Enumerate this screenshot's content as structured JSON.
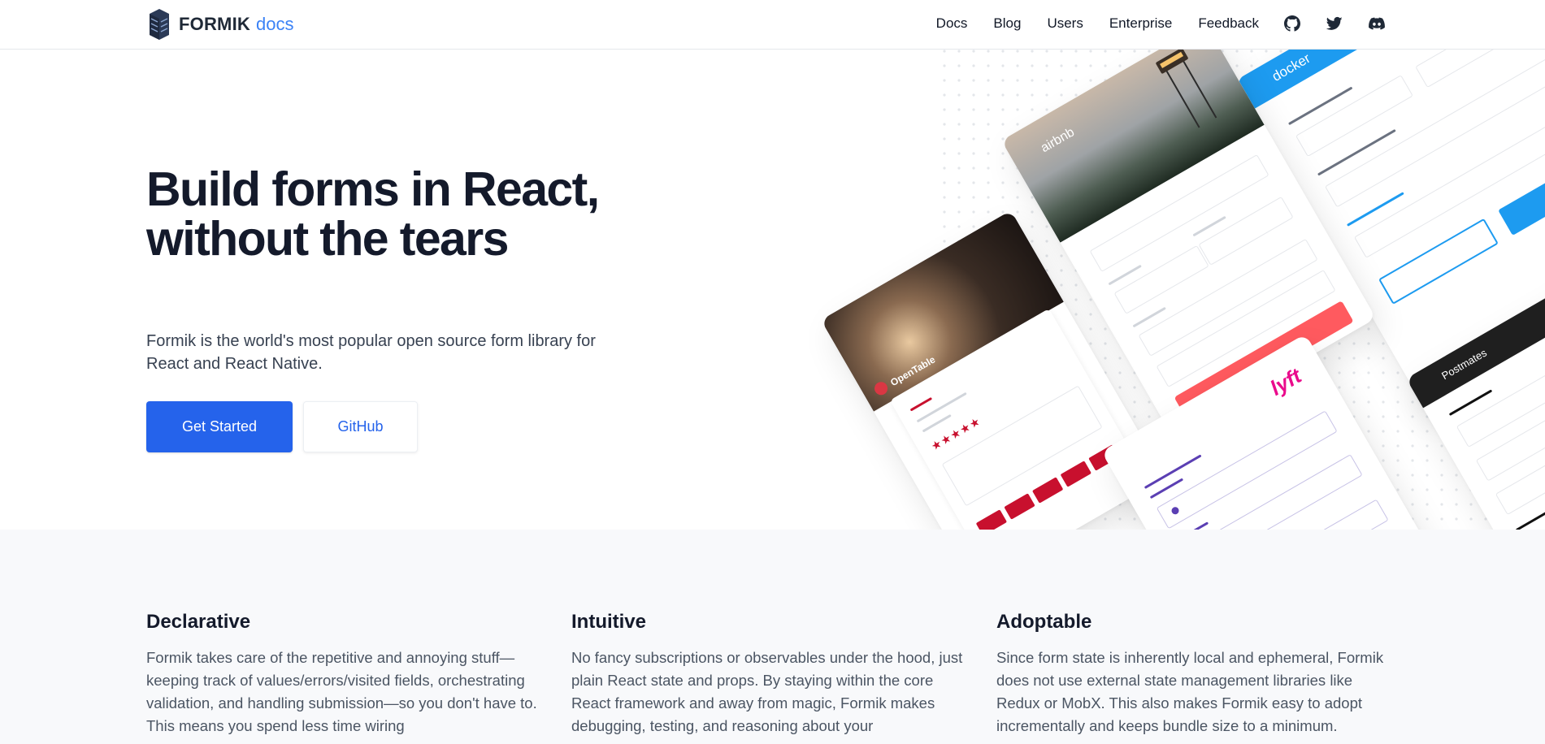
{
  "header": {
    "logo_word": "FORMIK",
    "logo_suffix": "docs",
    "nav": [
      {
        "label": "Docs"
      },
      {
        "label": "Blog"
      },
      {
        "label": "Users"
      },
      {
        "label": "Enterprise"
      },
      {
        "label": "Feedback"
      }
    ],
    "icons": [
      "github-icon",
      "twitter-icon",
      "discord-icon"
    ]
  },
  "hero": {
    "title": "Build forms in React, without the tears",
    "subtitle": "Formik is the world's most popular open source form library for React and React Native.",
    "primary_button": "Get Started",
    "secondary_button": "GitHub"
  },
  "collage": {
    "brands": [
      "airbnb",
      "docker",
      "OpenTable",
      "lyft",
      "Postmates"
    ],
    "rating_stars": "★★★★★",
    "colors": {
      "airbnb_button": "#ff5a5f",
      "docker_blue": "#1d9bf0",
      "opentable_red": "#c8102e",
      "lyft_pink": "#ea0b8c",
      "lyft_purple": "#5b3fb3",
      "postmates_dark": "#1f1f1f"
    }
  },
  "features": [
    {
      "title": "Declarative",
      "body": "Formik takes care of the repetitive and annoying stuff—keeping track of values/errors/visited fields, orchestrating validation, and handling submission—so you don't have to. This means you spend less time wiring"
    },
    {
      "title": "Intuitive",
      "body": "No fancy subscriptions or observables under the hood, just plain React state and props. By staying within the core React framework and away from magic, Formik makes debugging, testing, and reasoning about your"
    },
    {
      "title": "Adoptable",
      "body": "Since form state is inherently local and ephemeral, Formik does not use external state management libraries like Redux or MobX. This also makes Formik easy to adopt incrementally and keeps bundle size to a minimum."
    }
  ]
}
